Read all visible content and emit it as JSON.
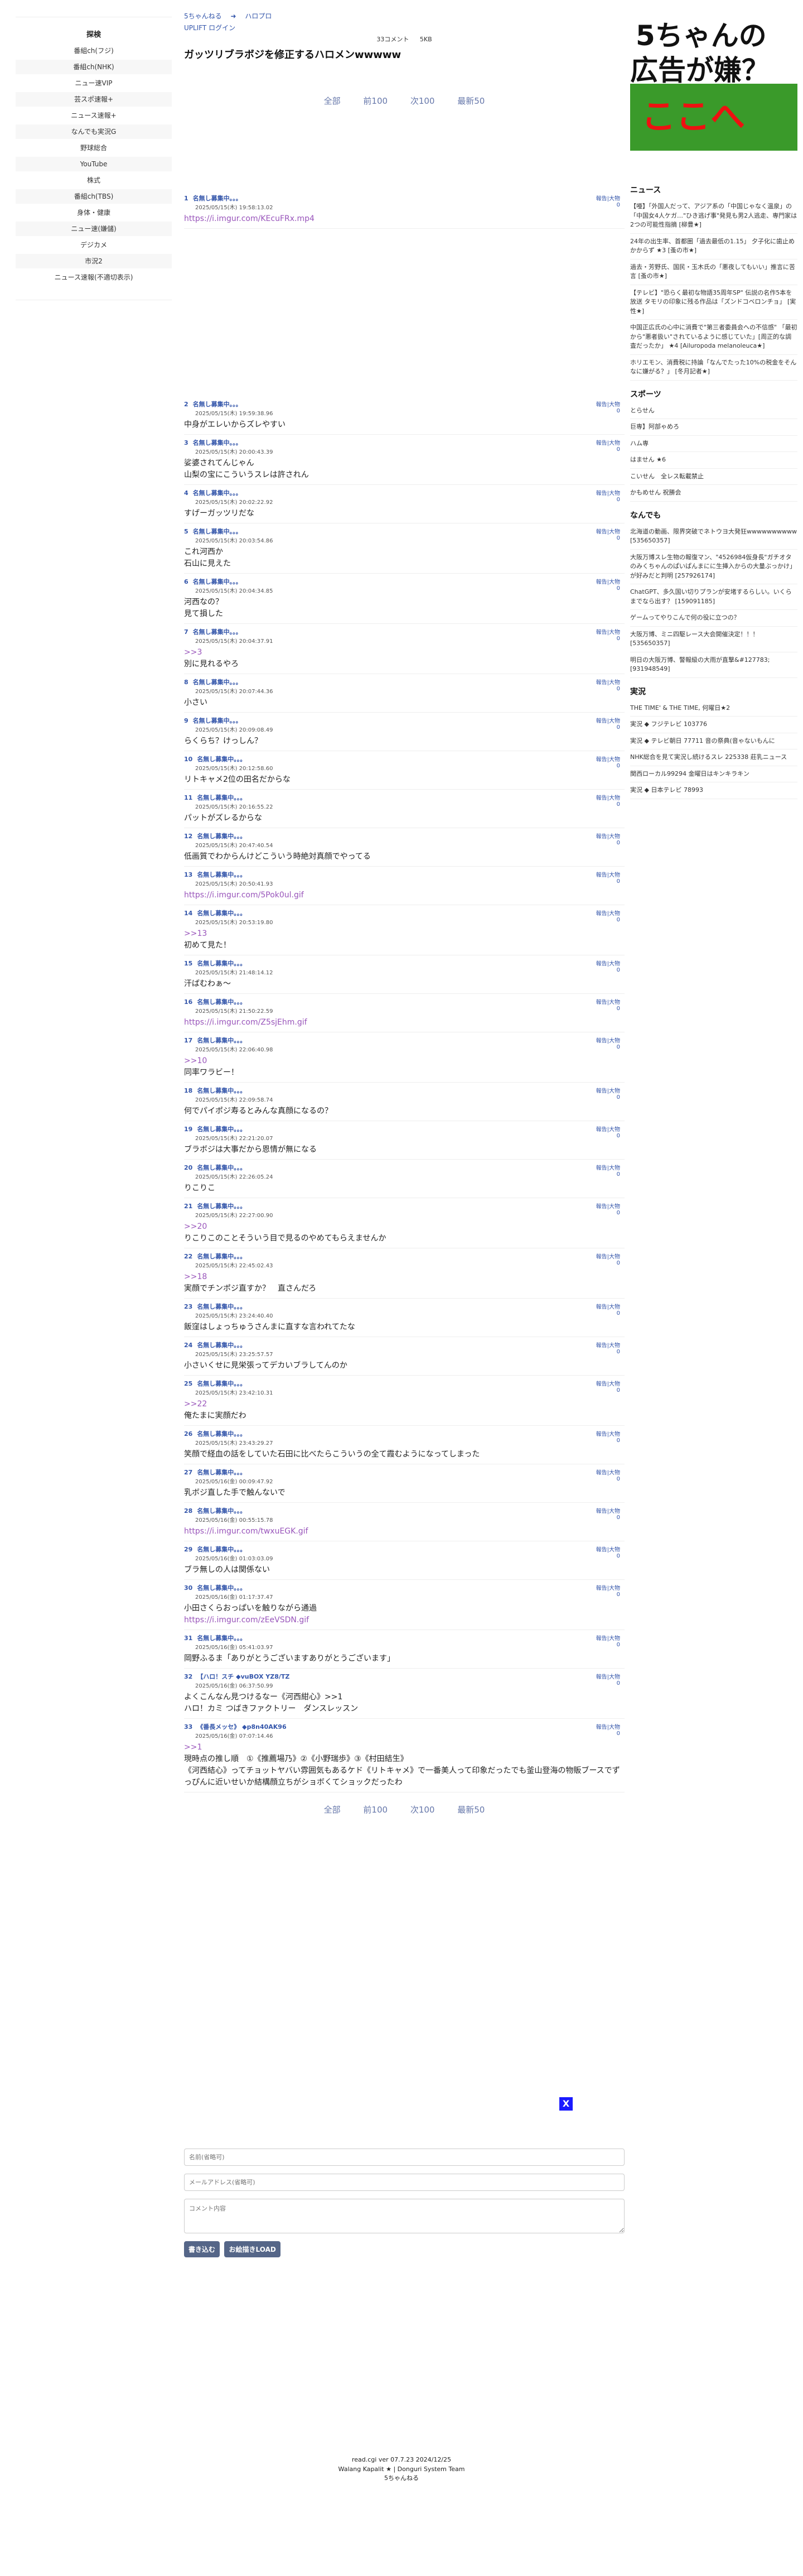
{
  "left": {
    "title": "探検",
    "items": [
      "番組ch(フジ)",
      "番組ch(NHK)",
      "ニュー速VIP",
      "芸スポ速報+",
      "ニュース速報+",
      "なんでも実況G",
      "野球総合",
      "YouTube",
      "株式",
      "番組ch(TBS)",
      "身体・健康",
      "ニュー速(嫌儲)",
      "デジカメ",
      "市況2",
      "ニュース速報(不適切表示)"
    ]
  },
  "header": {
    "crumb1": "5ちゃんねる",
    "arrow": "➜",
    "crumb2": "ハロプロ",
    "login": "UPLIFT ログイン",
    "stat1": "33コメント",
    "stat2": "5KB",
    "title": "ガッツリブラボジを修正するハロメンwwwww"
  },
  "nav": {
    "all": "全部",
    "prev": "前100",
    "next": "次100",
    "latest": "最新50"
  },
  "actions": {
    "report": "報告",
    "big": "大物",
    "zero": "0",
    "sep": "|"
  },
  "posts": [
    {
      "n": "1",
      "name": "名無し募集中。。。",
      "date": "2025/05/15(木) 19:58:13.02",
      "body": "",
      "link": "https://i.imgur.com/KEcuFRx.mp4"
    },
    {
      "n": "2",
      "name": "名無し募集中。。。",
      "date": "2025/05/15(木) 19:59:38.96",
      "body": "中身がエレいからズレやすい",
      "link": ""
    },
    {
      "n": "3",
      "name": "名無し募集中。。。",
      "date": "2025/05/15(木) 20:00:43.39",
      "body": "娑婆されてんじゃん\n山梨の宝にこういうスレは許されん",
      "link": ""
    },
    {
      "n": "4",
      "name": "名無し募集中。。。",
      "date": "2025/05/15(木) 20:02:22.92",
      "body": "すげーガッツリだな",
      "link": ""
    },
    {
      "n": "5",
      "name": "名無し募集中。。。",
      "date": "2025/05/15(木) 20:03:54.86",
      "body": "これ河西か\n石山に見えた",
      "link": ""
    },
    {
      "n": "6",
      "name": "名無し募集中。。。",
      "date": "2025/05/15(木) 20:04:34.85",
      "body": "河西なの？\n見て損した",
      "link": ""
    },
    {
      "n": "7",
      "name": "名無し募集中。。。",
      "date": "2025/05/15(木) 20:04:37.91",
      "rep": ">>3",
      "body": "別に見れるやろ",
      "link": ""
    },
    {
      "n": "8",
      "name": "名無し募集中。。。",
      "date": "2025/05/15(木) 20:07:44.36",
      "body": "小さい",
      "link": ""
    },
    {
      "n": "9",
      "name": "名無し募集中。。。",
      "date": "2025/05/15(木) 20:09:08.49",
      "body": "らくらち？けっしん？",
      "link": ""
    },
    {
      "n": "10",
      "name": "名無し募集中。。。",
      "date": "2025/05/15(木) 20:12:58.60",
      "body": "リトキャメ2位の田名だからな",
      "link": ""
    },
    {
      "n": "11",
      "name": "名無し募集中。。。",
      "date": "2025/05/15(木) 20:16:55.22",
      "body": "パットがズレるからな",
      "link": ""
    },
    {
      "n": "12",
      "name": "名無し募集中。。。",
      "date": "2025/05/15(木) 20:47:40.54",
      "body": "低画質でわからんけどこういう時絶対真顔でやってる",
      "link": ""
    },
    {
      "n": "13",
      "name": "名無し募集中。。。",
      "date": "2025/05/15(木) 20:50:41.93",
      "body": "",
      "link": "https://i.imgur.com/5Pok0ul.gif"
    },
    {
      "n": "14",
      "name": "名無し募集中。。。",
      "date": "2025/05/15(木) 20:53:19.80",
      "rep": ">>13",
      "body": "初めて見た！",
      "link": ""
    },
    {
      "n": "15",
      "name": "名無し募集中。。。",
      "date": "2025/05/15(木) 21:48:14.12",
      "body": "汗ばむわぁ〜",
      "link": ""
    },
    {
      "n": "16",
      "name": "名無し募集中。。。",
      "date": "2025/05/15(木) 21:50:22.59",
      "body": "",
      "link": "https://i.imgur.com/Z5sjEhm.gif"
    },
    {
      "n": "17",
      "name": "名無し募集中。。。",
      "date": "2025/05/15(木) 22:06:40.98",
      "rep": ">>10",
      "body": "同率ワラビー！",
      "link": ""
    },
    {
      "n": "18",
      "name": "名無し募集中。。。",
      "date": "2025/05/15(木) 22:09:58.74",
      "body": "何でパイポジ寿るとみんな真顔になるの？",
      "link": ""
    },
    {
      "n": "19",
      "name": "名無し募集中。。。",
      "date": "2025/05/15(木) 22:21:20.07",
      "body": "ブラボジは大事だから恩情が無になる",
      "link": ""
    },
    {
      "n": "20",
      "name": "名無し募集中。。。",
      "date": "2025/05/15(木) 22:26:05.24",
      "body": "りこりこ",
      "link": ""
    },
    {
      "n": "21",
      "name": "名無し募集中。。。",
      "date": "2025/05/15(木) 22:27:00.90",
      "rep": ">>20",
      "body": "りこりこのことそういう目で見るのやめてもらえませんか",
      "link": ""
    },
    {
      "n": "22",
      "name": "名無し募集中。。。",
      "date": "2025/05/15(木) 22:45:02.43",
      "rep": ">>18",
      "body": "実顔でチンポジ直すか？　直さんだろ",
      "link": ""
    },
    {
      "n": "23",
      "name": "名無し募集中。。。",
      "date": "2025/05/15(木) 23:24:40.40",
      "body": "飯窪はしょっちゅうさんまに直すな言われてたな",
      "link": ""
    },
    {
      "n": "24",
      "name": "名無し募集中。。。",
      "date": "2025/05/15(木) 23:25:57.57",
      "body": "小さいくせに見栄張ってデカいブラしてんのか",
      "link": ""
    },
    {
      "n": "25",
      "name": "名無し募集中。。。",
      "date": "2025/05/15(木) 23:42:10.31",
      "rep": ">>22",
      "body": "俺たまに実顔だわ",
      "link": ""
    },
    {
      "n": "26",
      "name": "名無し募集中。。。",
      "date": "2025/05/15(木) 23:43:29.27",
      "body": "笑顔で経血の話をしていた石田に比べたらこういうの全て霞むようになってしまった",
      "link": ""
    },
    {
      "n": "27",
      "name": "名無し募集中。。。",
      "date": "2025/05/16(金) 00:09:47.92",
      "body": "乳ボジ直した手で触んないで",
      "link": ""
    },
    {
      "n": "28",
      "name": "名無し募集中。。。",
      "date": "2025/05/16(金) 00:55:15.78",
      "body": "",
      "link": "https://i.imgur.com/twxuEGK.gif"
    },
    {
      "n": "29",
      "name": "名無し募集中。。。",
      "date": "2025/05/16(金) 01:03:03.09",
      "body": "ブラ無しの人は関係ない",
      "link": ""
    },
    {
      "n": "30",
      "name": "名無し募集中。。。",
      "date": "2025/05/16(金) 01:17:37.47",
      "body": "小田さくらおっぱいを触りながら通過",
      "link": "https://i.imgur.com/zEeVSDN.gif"
    },
    {
      "n": "31",
      "name": "名無し募集中。。。",
      "date": "2025/05/16(金) 05:41:03.97",
      "body": "岡野ふるま「ありがとうございますありがとうございます」",
      "link": ""
    },
    {
      "n": "32",
      "name": "【ハロ！スチ ◆vuBOX YZ8/TZ",
      "date": "2025/05/16(金) 06:37:50.99",
      "body": "よくこんなん見つけるなー《河西紺心》>>1\nハロ！カミ つばきファクトリー　ダンスレッスン",
      "link": ""
    },
    {
      "n": "33",
      "name": "《番長メッセ》 ◆p8n40AK96",
      "date": "2025/05/16(金) 07:07:14.46",
      "rep": ">>1",
      "body": "現時点の推し順　①《推薦場乃》②《小野瑞歩》③《村田結生》\n《河西結心》ってチョットヤバい雰囲気もあるケド《リトキャメ》で一番美人って印象だったでも釜山登海の物販ブースでずっぴんに近いせいか結構顔立ちがショボくてショックだったわ",
      "link": ""
    }
  ],
  "right": {
    "ad": {
      "l1": "5ちゃんの",
      "l2": "広告が嫌？",
      "l3": "ここへ"
    },
    "news_h": "ニュース",
    "news": [
      "【唖】「外国人だって、アジア系の「中国じゃなく温泉」の「中国女4人ケガ…\"ひき逃げ事\"発見も男2人逃走、専門家は2つの可能性指摘 [柳豊★]",
      "24年の出生率、首都圏「過去最低の1.15」 夕子化に歯止めかからず ★3 [蚤の市★]",
      "過去・芳野氏、国民・玉木氏の「悪夜してもいい」推言に苦言 [蚤の市★]",
      "【テレビ】\"恐らく最初な物語35周年SP\" 伝説の名作5本を放送 タモリの印象に残る作品は「ズンドコベロンチョ」 [実性★]",
      "中国正広氏の心中に消費で\"第三者委員会への不信感\" 「最初から\"悪者扱い\"されているように感じていた」[周正的な調査だったか」 ★4 [Ailuropoda melanoleuca★]",
      "ホリエモン、消費税に持論「なんでたった10%の税金をそんなに嫌がる？」 [冬月記者★]"
    ],
    "sports_h": "スポーツ",
    "sports": [
      "とらせん",
      "巨専】阿部ゃめろ",
      "ハム専",
      "はません ★6",
      "こいせん　全レス転載禁止",
      "かもめせん 祝勝会"
    ],
    "misc_h": "なんでも",
    "misc": [
      "北海道の動画、限界突破でネトウヨ大発狂wwwwwwwwww [535650357]",
      "大阪万博スレ生物の報復マン、\"4526984仮身長\"ガチオタのみくちゃんのぱいぱんまにに生挿入からの大量ぶっかけ」が好みだと判明 [257926174]",
      "ChatGPT、多久国い切りプランが安堵するらしい。いくらまでなら出す？ [159091185]",
      "ゲームってやりこんで何の役に立つの？",
      "大阪万博、ミニ四駆レース大会開催決定！！！[535650357]",
      "明日の大阪万博、警報級の大雨が直撃&#127783; [931948549]"
    ],
    "live_h": "実況",
    "live": [
      "THE TIME' & THE TIME, 何曜日★2",
      "実況 ◆ フジテレビ 103776",
      "実況 ◆ テレビ朝日 77711 音の祭典(音ゃないもんに",
      "NHK総合を見て実況し続けるスレ 225338 莊乳ニュース",
      "関西ローカル99294 金曜日はキンキラキン",
      "実況 ◆ 日本テレビ 78993"
    ]
  },
  "close": "X",
  "form": {
    "name_ph": "名前(省略可)",
    "mail_ph": "メールアドレス(省略可)",
    "comment_ph": "コメント内容",
    "submit": "書き込む",
    "load": "お絵描きLOAD"
  },
  "footer": {
    "l1": "read.cgi ver 07.7.23 2024/12/25",
    "l2": "Walang Kapalit ★ | Donguri System Team",
    "l3": "5ちゃんねる"
  }
}
